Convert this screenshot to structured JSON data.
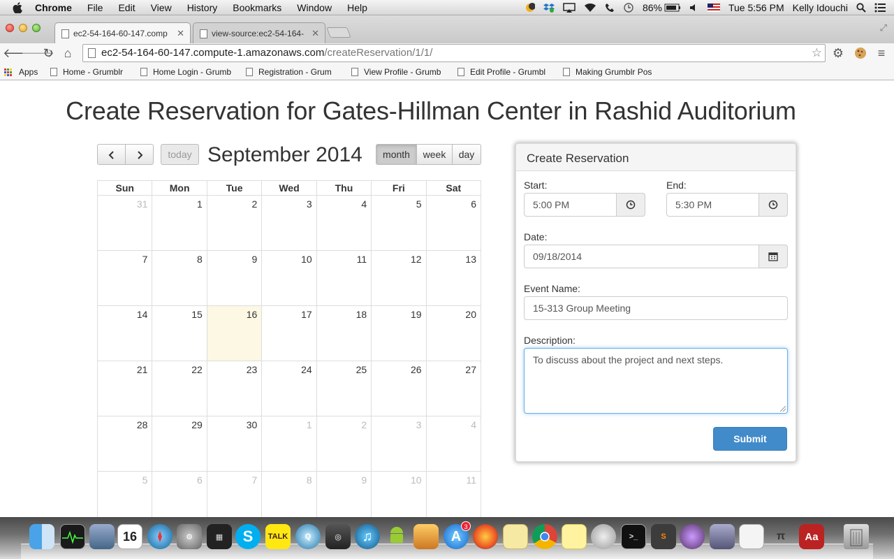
{
  "menubar": {
    "app_name": "Chrome",
    "items": [
      "File",
      "Edit",
      "View",
      "History",
      "Bookmarks",
      "Window",
      "Help"
    ],
    "battery": "86%",
    "clock": "Tue 5:56 PM",
    "user": "Kelly Idouchi"
  },
  "tabs": [
    {
      "title": "ec2-54-164-60-147.comp",
      "active": true
    },
    {
      "title": "view-source:ec2-54-164-",
      "active": false
    }
  ],
  "address_bar": {
    "host": "ec2-54-164-60-147.compute-1.amazonaws.com",
    "path": "/createReservation/1/1/"
  },
  "bookmarks": {
    "apps_label": "Apps",
    "items": [
      "Home - Grumblr",
      "Home Login - Grumb",
      "Registration - Grum",
      "View Profile - Grumb",
      "Edit Profile - Grumbl",
      "Making Grumblr Pos"
    ]
  },
  "page": {
    "title": "Create Reservation for Gates-Hillman Center in Rashid Auditorium"
  },
  "calendar": {
    "title": "September 2014",
    "today_label": "today",
    "view_buttons": {
      "month": "month",
      "week": "week",
      "day": "day"
    },
    "day_headers": [
      "Sun",
      "Mon",
      "Tue",
      "Wed",
      "Thu",
      "Fri",
      "Sat"
    ],
    "weeks": [
      [
        "31",
        "1",
        "2",
        "3",
        "4",
        "5",
        "6"
      ],
      [
        "7",
        "8",
        "9",
        "10",
        "11",
        "12",
        "13"
      ],
      [
        "14",
        "15",
        "16",
        "17",
        "18",
        "19",
        "20"
      ],
      [
        "21",
        "22",
        "23",
        "24",
        "25",
        "26",
        "27"
      ],
      [
        "28",
        "29",
        "30",
        "1",
        "2",
        "3",
        "4"
      ],
      [
        "5",
        "6",
        "7",
        "8",
        "9",
        "10",
        "11"
      ]
    ]
  },
  "form": {
    "heading": "Create Reservation",
    "start_label": "Start:",
    "start_value": "5:00 PM",
    "end_label": "End:",
    "end_value": "5:30 PM",
    "date_label": "Date:",
    "date_value": "09/18/2014",
    "event_label": "Event Name:",
    "event_value": "15-313 Group Meeting",
    "description_label": "Description:",
    "description_value": "To discuss about the project and next steps.",
    "submit_label": "Submit"
  },
  "dock": {
    "calendar_date": "16",
    "appstore_badge": "3",
    "talk_label": "TALK"
  },
  "colors": {
    "primary_button": "#428bca",
    "today_highlight": "#fcf8e3",
    "focus_border": "#66afe9"
  }
}
